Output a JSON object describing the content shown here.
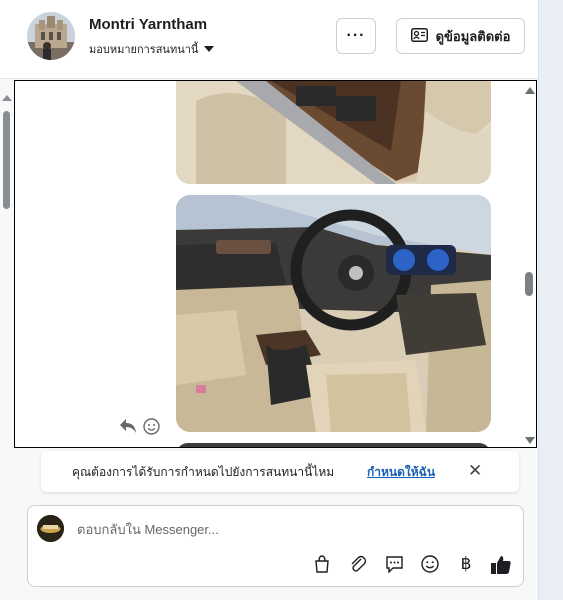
{
  "header": {
    "contact_name": "Montri Yarntham",
    "assign_label": "มอบหมายการสนทนานี้",
    "more_label": "···",
    "contact_info_label": "ดูข้อมูลติดต่อ"
  },
  "assign_prompt": {
    "question": "คุณต้องการได้รับการกำหนดไปยังการสนทนานี้ไหม",
    "link": "กำหนดให้ฉัน",
    "close_glyph": "✕"
  },
  "composer": {
    "placeholder": "ตอบกลับใน Messenger...",
    "tools": [
      "shopping-bag-icon",
      "attachment-icon",
      "saved-reply-icon",
      "emoji-icon",
      "baht-icon",
      "thumbs-up-icon"
    ],
    "baht_glyph": "฿"
  },
  "messages": [
    {
      "type": "image",
      "subject": "car-door-panel-photo"
    },
    {
      "type": "image",
      "subject": "car-interior-dashboard-photo"
    },
    {
      "type": "image",
      "subject": "car-photo-partial"
    }
  ],
  "colors": {
    "link": "#1a5fb4",
    "thumb_up": "#1c1e21",
    "page_bg": "#f7f8fa"
  }
}
